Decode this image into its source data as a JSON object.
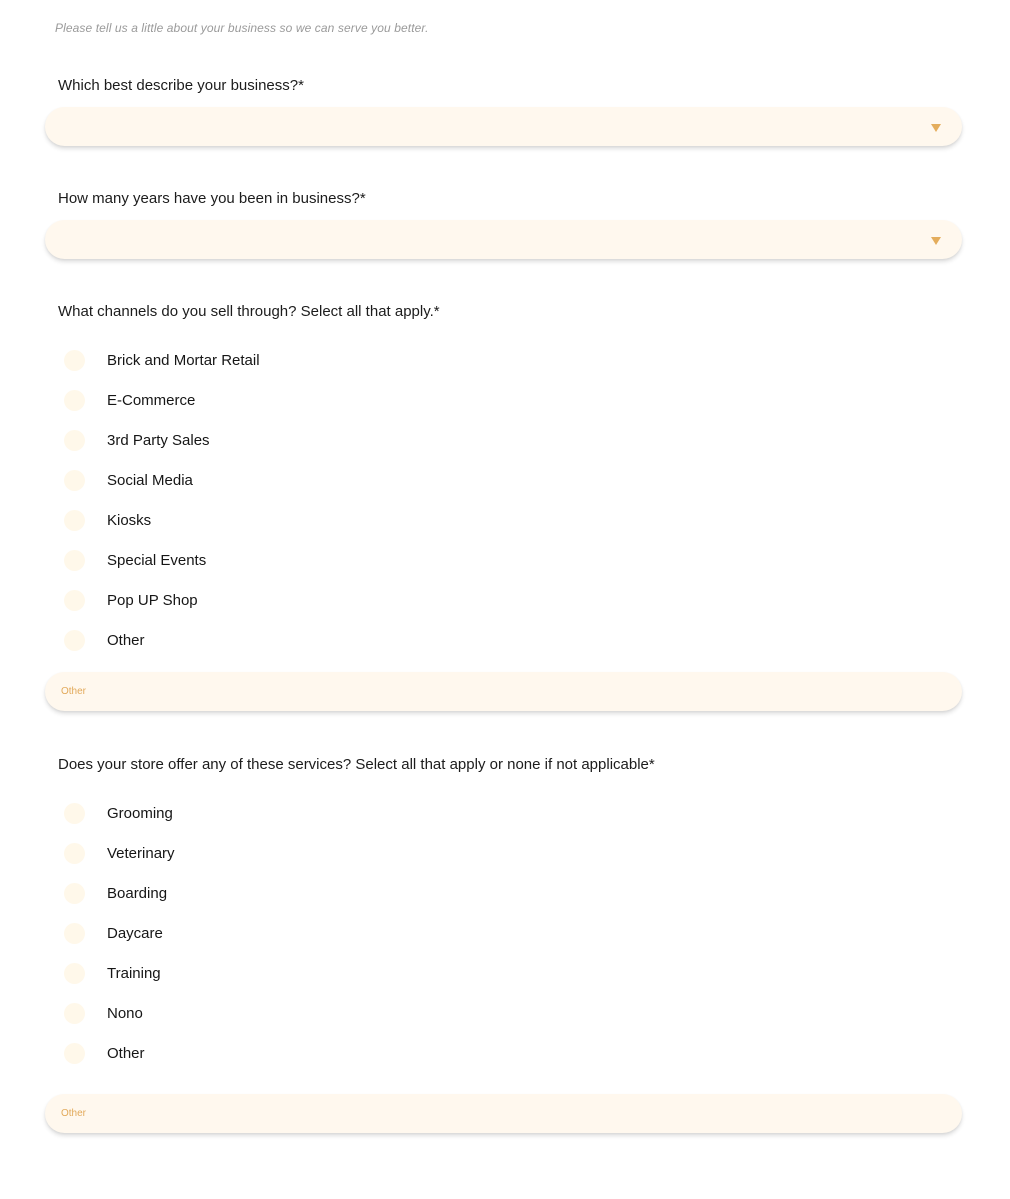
{
  "intro": "Please tell us a little about your business so we can serve you better.",
  "colors": {
    "field_bg": "#fff8ee",
    "radio_bg": "#fff8ea",
    "accent": "#e4ad5c",
    "placeholder": "#e2a95a"
  },
  "questions": {
    "business_type": {
      "label": "Which best describe your business?*",
      "value": "",
      "icon": "caret-down-icon"
    },
    "years_in_business": {
      "label": "How many years have you been in business?*",
      "value": "",
      "icon": "caret-down-icon"
    },
    "channels": {
      "label": "What channels do you sell through? Select all that apply.*",
      "options": [
        {
          "label": "Brick and Mortar Retail",
          "checked": false
        },
        {
          "label": "E-Commerce",
          "checked": false
        },
        {
          "label": "3rd Party Sales",
          "checked": false
        },
        {
          "label": "Social Media",
          "checked": false
        },
        {
          "label": "Kiosks",
          "checked": false
        },
        {
          "label": "Special Events",
          "checked": false
        },
        {
          "label": "Pop UP Shop",
          "checked": false
        },
        {
          "label": "Other",
          "checked": false
        }
      ],
      "other_input": {
        "placeholder": "Other",
        "value": ""
      }
    },
    "services": {
      "label": "Does your store offer any of these services? Select all that apply or none if not applicable*",
      "options": [
        {
          "label": "Grooming",
          "checked": false
        },
        {
          "label": "Veterinary",
          "checked": false
        },
        {
          "label": "Boarding",
          "checked": false
        },
        {
          "label": "Daycare",
          "checked": false
        },
        {
          "label": "Training",
          "checked": false
        },
        {
          "label": "Nono",
          "checked": false
        },
        {
          "label": "Other",
          "checked": false
        }
      ],
      "other_input": {
        "placeholder": "Other",
        "value": ""
      }
    }
  }
}
